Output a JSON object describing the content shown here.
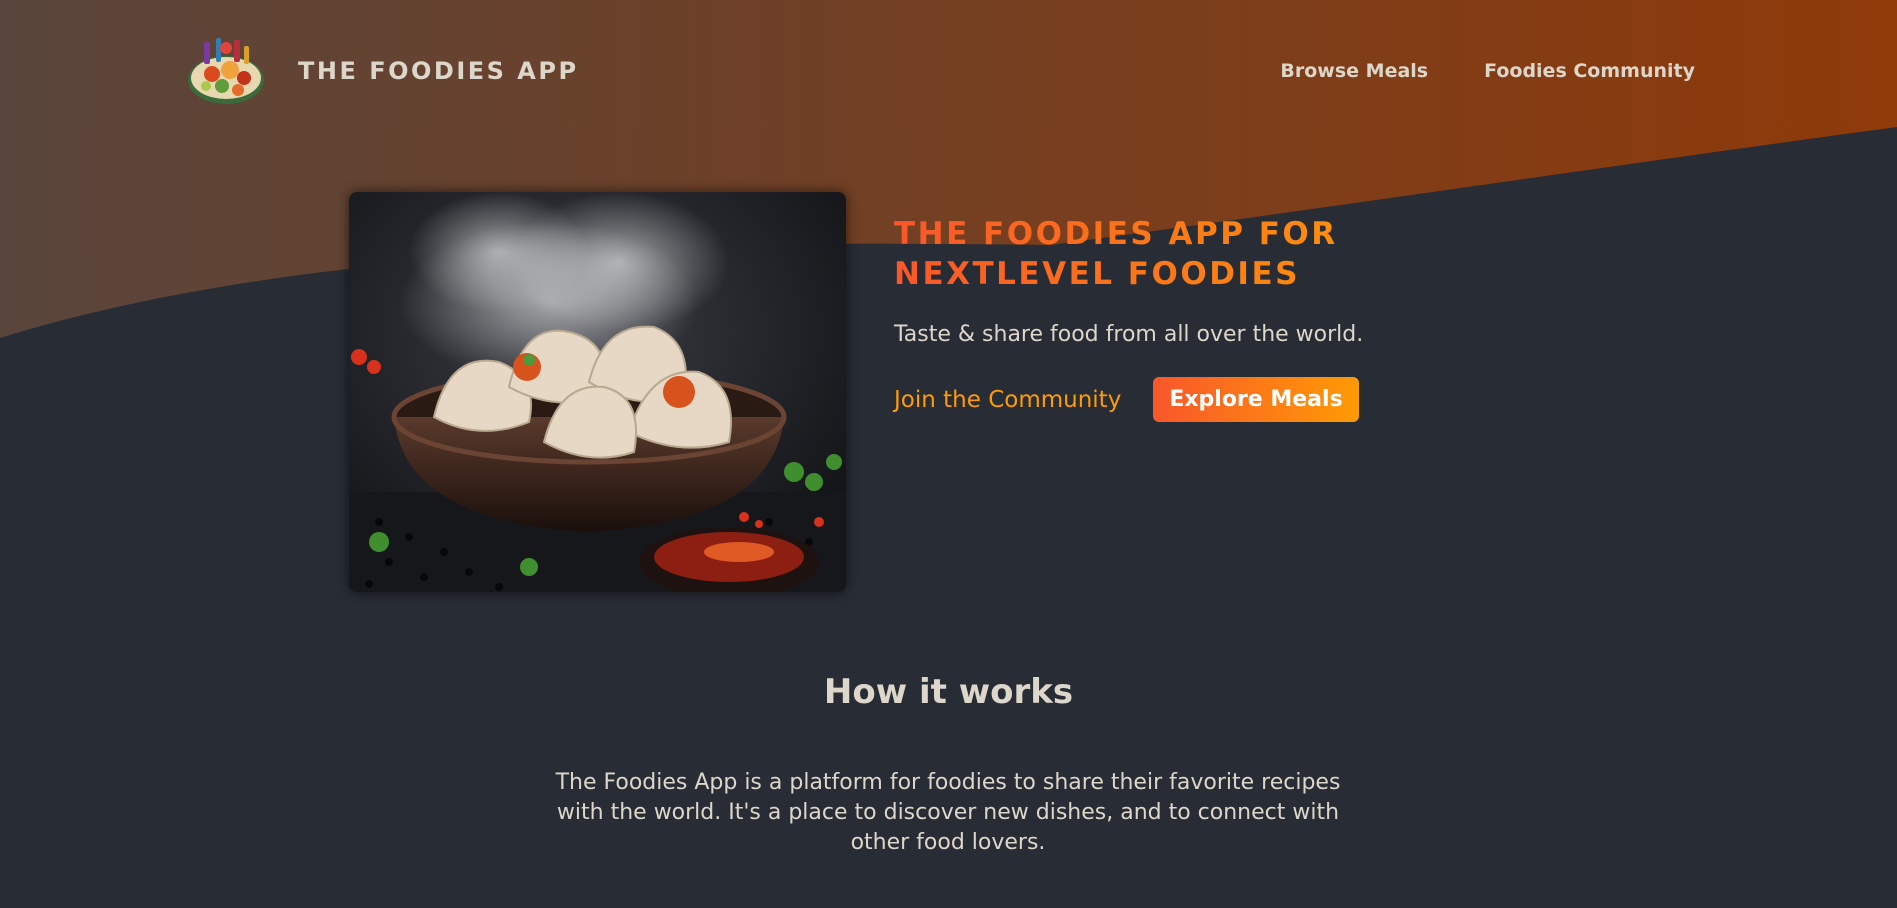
{
  "header": {
    "logo_icon": "food-plate-logo",
    "title": "THE FOODIES APP",
    "nav": [
      {
        "label": "Browse Meals"
      },
      {
        "label": "Foodies Community"
      }
    ]
  },
  "hero": {
    "image_icon": "dumplings-photo",
    "title": "THE FOODIES APP FOR NEXTLEVEL FOODIES",
    "subtitle": "Taste & share food from all over the world.",
    "join_link": "Join the Community",
    "explore_button": "Explore Meals"
  },
  "how": {
    "title": "How it works",
    "text": "The Foodies App is a platform for foodies to share their favorite recipes with the world. It's a place to discover new dishes, and to connect with other food lovers."
  },
  "colors": {
    "background": "#282c34",
    "header_gradient_start": "#59453c",
    "header_gradient_end": "#8f3a09",
    "accent_start": "#f9572a",
    "accent_end": "#ff9b05",
    "text": "#ddd6cb"
  }
}
